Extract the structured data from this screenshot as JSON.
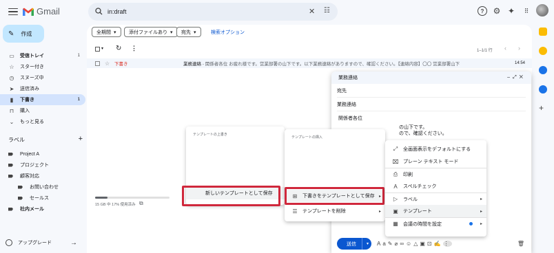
{
  "app": {
    "name": "Gmail"
  },
  "search": {
    "query": "in:draft"
  },
  "compose_button": "作成",
  "nav": [
    {
      "label": "受信トレイ",
      "count": "1",
      "icon": "inbox-icon",
      "bold": true
    },
    {
      "label": "スター付き",
      "count": "",
      "icon": "star-icon"
    },
    {
      "label": "スヌーズ中",
      "count": "",
      "icon": "clock-icon"
    },
    {
      "label": "送信済み",
      "count": "",
      "icon": "send-icon"
    },
    {
      "label": "下書き",
      "count": "1",
      "icon": "draft-icon",
      "active": true
    },
    {
      "label": "購入",
      "count": "",
      "icon": "bag-icon"
    },
    {
      "label": "もっと見る",
      "count": "",
      "icon": "chevron-down-icon"
    }
  ],
  "labels": {
    "heading": "ラベル",
    "items": [
      {
        "label": "Project A",
        "sub": false
      },
      {
        "label": "プロジェクト",
        "sub": false
      },
      {
        "label": "顧客対応",
        "sub": false
      },
      {
        "label": "お問い合わせ",
        "sub": true
      },
      {
        "label": "セールス",
        "sub": true
      },
      {
        "label": "社内メール",
        "sub": false,
        "bold": true
      }
    ]
  },
  "upgrade": "アップグレード",
  "filters": {
    "period": "全期間",
    "attachment": "添付ファイルあり",
    "to": "宛先",
    "advanced": "検索オプション"
  },
  "pagination": "1–1/1 行",
  "draft_row": {
    "label": "下書き",
    "subject": "業務連絡",
    "snippet": " - 関係者各位 お疲れ様です。営業部署の山下です。以下業務連絡がありますので、確認ください。【連絡内容】〇〇 営業部署山下",
    "time": "14:54"
  },
  "storage": {
    "text": "15 GB 中 17% 使用済み",
    "percent": 17
  },
  "compose_window": {
    "title": "業務連絡",
    "to_label": "宛先",
    "subject": "業務連絡",
    "body_line1": "関係者各位",
    "body_line2": "の山下です。",
    "body_line3": "ので、確認ください。",
    "send": "送信"
  },
  "template_panel_left": {
    "title": "テンプレートの上書き",
    "item": "新しいテンプレートとして保存"
  },
  "template_panel_mid": {
    "title": "テンプレートの挿入",
    "save_draft": "下書きをテンプレートとして保存",
    "delete": "テンプレートを削除"
  },
  "more_menu": [
    {
      "label": "全画面表示をデフォルトにする",
      "icon": "expand-icon",
      "chev": false
    },
    {
      "label": "プレーン テキスト モード",
      "icon": "plain-text-icon",
      "chev": false
    },
    {
      "label": "印刷",
      "icon": "print-icon",
      "chev": false
    },
    {
      "label": "スペルチェック",
      "icon": "spellcheck-icon",
      "chev": false
    },
    {
      "label": "ラベル",
      "icon": "label-icon",
      "chev": true
    },
    {
      "label": "テンプレート",
      "icon": "template-icon",
      "chev": true
    },
    {
      "label": "会議の時間を設定",
      "icon": "calendar-icon",
      "chev": false
    }
  ]
}
